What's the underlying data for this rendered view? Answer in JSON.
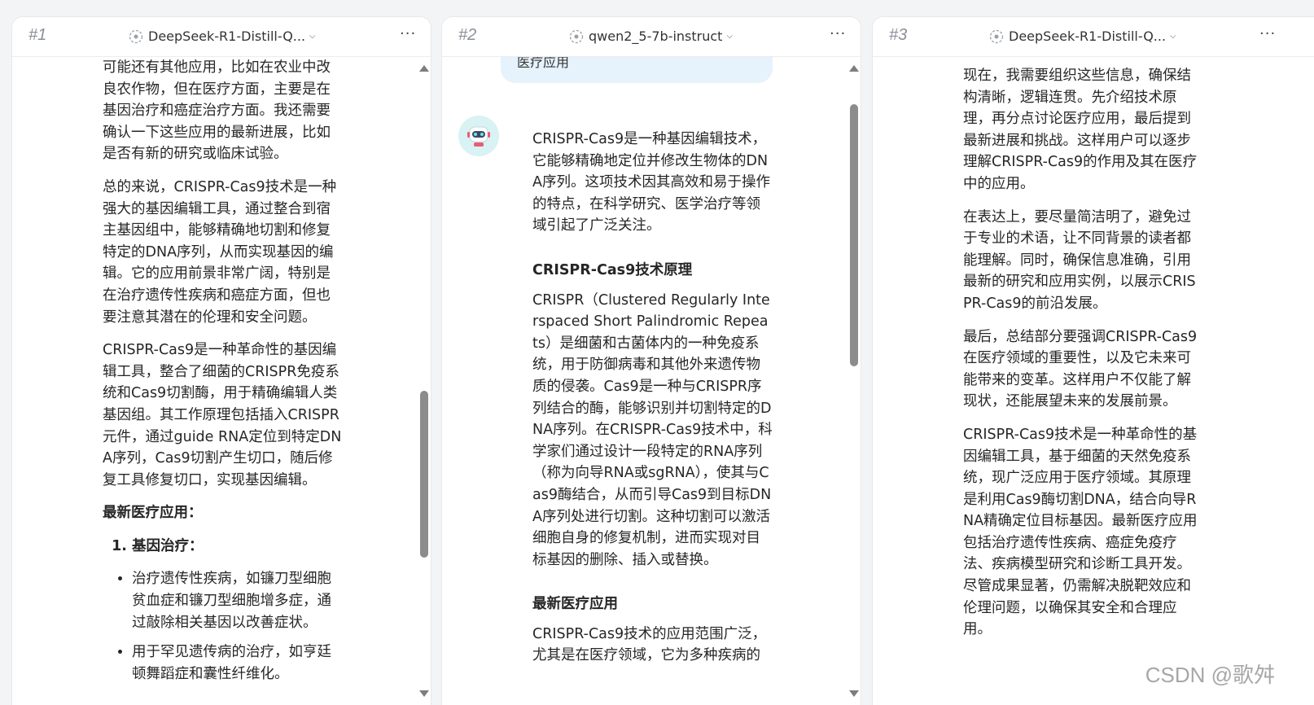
{
  "panels": [
    {
      "number": "#1",
      "model": "DeepSeek-R1-Distill-Q...",
      "more": "···",
      "paragraphs": [
        "可能还有其他应用，比如在农业中改良农作物，但在医疗方面，主要是在基因治疗和癌症治疗方面。我还需要确认一下这些应用的最新进展，比如是否有新的研究或临床试验。",
        "总的来说，CRISPR-Cas9技术是一种强大的基因编辑工具，通过整合到宿主基因组中，能够精确地切割和修复特定的DNA序列，从而实现基因的编辑。它的应用前景非常广阔，特别是在治疗遗传性疾病和癌症方面，但也要注意其潜在的伦理和安全问题。",
        "CRISPR-Cas9是一种革命性的基因编辑工具，整合了细菌的CRISPR免疫系统和Cas9切割酶，用于精确编辑人类基因组。其工作原理包括插入CRISPR元件，通过guide RNA定位到特定DNA序列，Cas9切割产生切口，随后修复工具修复切口，实现基因编辑。"
      ],
      "heading": "最新医疗应用：",
      "ol_item": "基因治疗：",
      "bullets": [
        "治疗遗传性疾病，如镰刀型细胞贫血症和镰刀型细胞增多症，通过敲除相关基因以改善症状。",
        "用于罕见遗传病的治疗，如亨廷顿舞蹈症和囊性纤维化。"
      ]
    },
    {
      "number": "#2",
      "model": "qwen2_5-7b-instruct",
      "more": "···",
      "bubble": "医疗应用",
      "intro": "CRISPR-Cas9是一种基因编辑技术，它能够精确地定位并修改生物体的DNA序列。这项技术因其高效和易于操作的特点，在科学研究、医学治疗等领域引起了广泛关注。",
      "heading1": "CRISPR-Cas9技术原理",
      "body1": "CRISPR（Clustered Regularly Interspaced Short Palindromic Repeats）是细菌和古菌体内的一种免疫系统，用于防御病毒和其他外来遗传物质的侵袭。Cas9是一种与CRISPR序列结合的酶，能够识别并切割特定的DNA序列。在CRISPR-Cas9技术中，科学家们通过设计一段特定的RNA序列（称为向导RNA或sgRNA），使其与Cas9酶结合，从而引导Cas9到目标DNA序列处进行切割。这种切割可以激活细胞自身的修复机制，进而实现对目标基因的删除、插入或替换。",
      "heading2": "最新医疗应用",
      "body2": "CRISPR-Cas9技术的应用范围广泛，尤其是在医疗领域，它为多种疾病的"
    },
    {
      "number": "#3",
      "model": "DeepSeek-R1-Distill-Q...",
      "more": "···",
      "paragraphs": [
        "现在，我需要组织这些信息，确保结构清晰，逻辑连贯。先介绍技术原理，再分点讨论医疗应用，最后提到最新进展和挑战。这样用户可以逐步理解CRISPR-Cas9的作用及其在医疗中的应用。",
        "在表达上，要尽量简洁明了，避免过于专业的术语，让不同背景的读者都能理解。同时，确保信息准确，引用最新的研究和应用实例，以展示CRISPR-Cas9的前沿发展。",
        "最后，总结部分要强调CRISPR-Cas9在医疗领域的重要性，以及它未来可能带来的变革。这样用户不仅能了解现状，还能展望未来的发展前景。",
        "CRISPR-Cas9技术是一种革命性的基因编辑工具，基于细菌的天然免疫系统，现广泛应用于医疗领域。其原理是利用Cas9酶切割DNA，结合向导RNA精确定位目标基因。最新医疗应用包括治疗遗传性疾病、癌症免疫疗法、疾病模型研究和诊断工具开发。尽管成果显著，仍需解决脱靶效应和伦理问题，以确保其安全和合理应用。"
      ]
    }
  ],
  "watermark": "CSDN @歌舛",
  "colors": {
    "bubble": "#e6f2fc",
    "avatar_bg": "#d9f2f4",
    "background": "#f3f4f6"
  }
}
